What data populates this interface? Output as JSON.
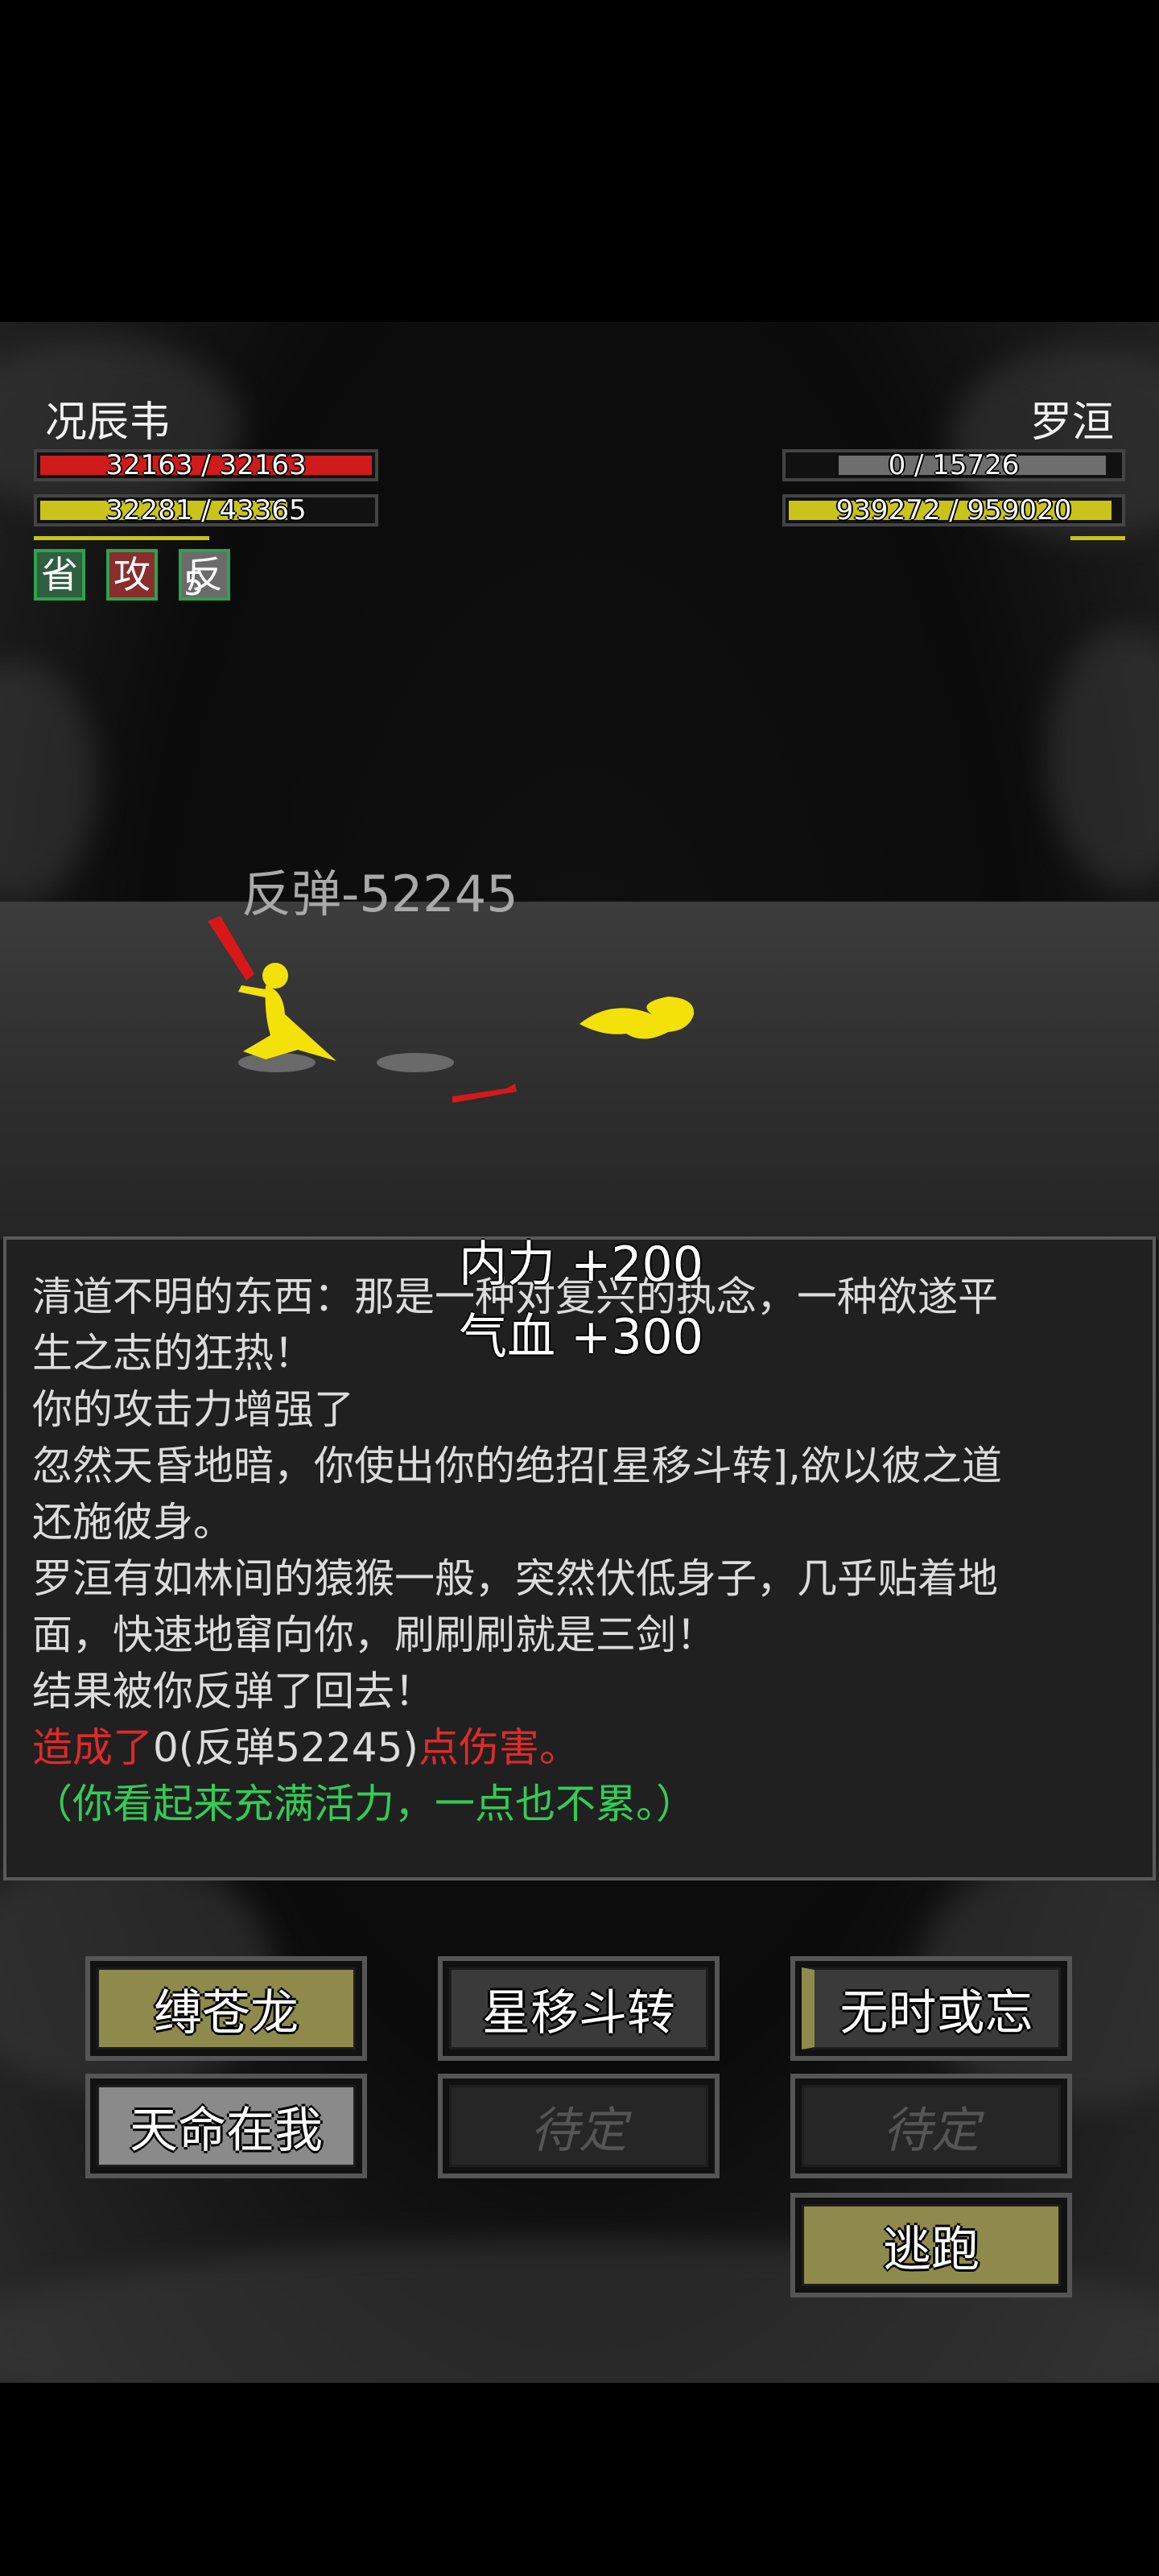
{
  "player": {
    "name": "况辰韦",
    "hp_text": "32163 / 32163",
    "hp_ratio": 1.0,
    "mp_text": "32281 / 43365",
    "mp_ratio": 0.744,
    "buffs": [
      {
        "label": "省",
        "bg": "#2f5f3f"
      },
      {
        "label": "攻",
        "bg": "#8a2d2d"
      },
      {
        "label": "反",
        "bg": "#6b6b6b",
        "count": "5"
      }
    ]
  },
  "enemy": {
    "name": "罗洹",
    "hp_text": "0 / 15726",
    "hp_ratio": 0.0,
    "mp_text": "939272 / 959020",
    "mp_ratio": 0.979
  },
  "floating_text": "反弹-52245",
  "log": {
    "lines": [
      "清道不明的东西：那是一种对复兴的执念，一种欲遂平",
      "生之志的狂热！",
      "你的攻击力增强了",
      "忽然天昏地暗，你使出你的绝招[星移斗转],欲以彼之道",
      "还施彼身。",
      "罗洹有如林间的猿猴一般，突然伏低身子，几乎贴着地",
      "面，快速地窜向你，刷刷刷就是三剑！",
      "结果被你反弹了回去！"
    ],
    "damage_prefix": "造成了",
    "damage_value": "0(反弹52245)",
    "damage_suffix": "点伤害。",
    "status": "（你看起来充满活力，一点也不累。）"
  },
  "gains": {
    "neili": "内力 +200",
    "qixue": "气血 +300"
  },
  "skills": [
    {
      "label": "缚苍龙",
      "state": "gold"
    },
    {
      "label": "星移斗转",
      "state": "dark"
    },
    {
      "label": "无时或忘",
      "state": "dark"
    },
    {
      "label": "天命在我",
      "state": "gray"
    },
    {
      "label": "待定",
      "state": "disabled"
    },
    {
      "label": "待定",
      "state": "disabled"
    }
  ],
  "flee_label": "逃跑",
  "colors": {
    "hp": "#d11a1a",
    "mp": "#c9c31a",
    "empty": "#6e6e6e",
    "damage": "#e02a2a",
    "status": "#33cc55",
    "character": "#f5e10a",
    "weapon": "#d81818"
  }
}
